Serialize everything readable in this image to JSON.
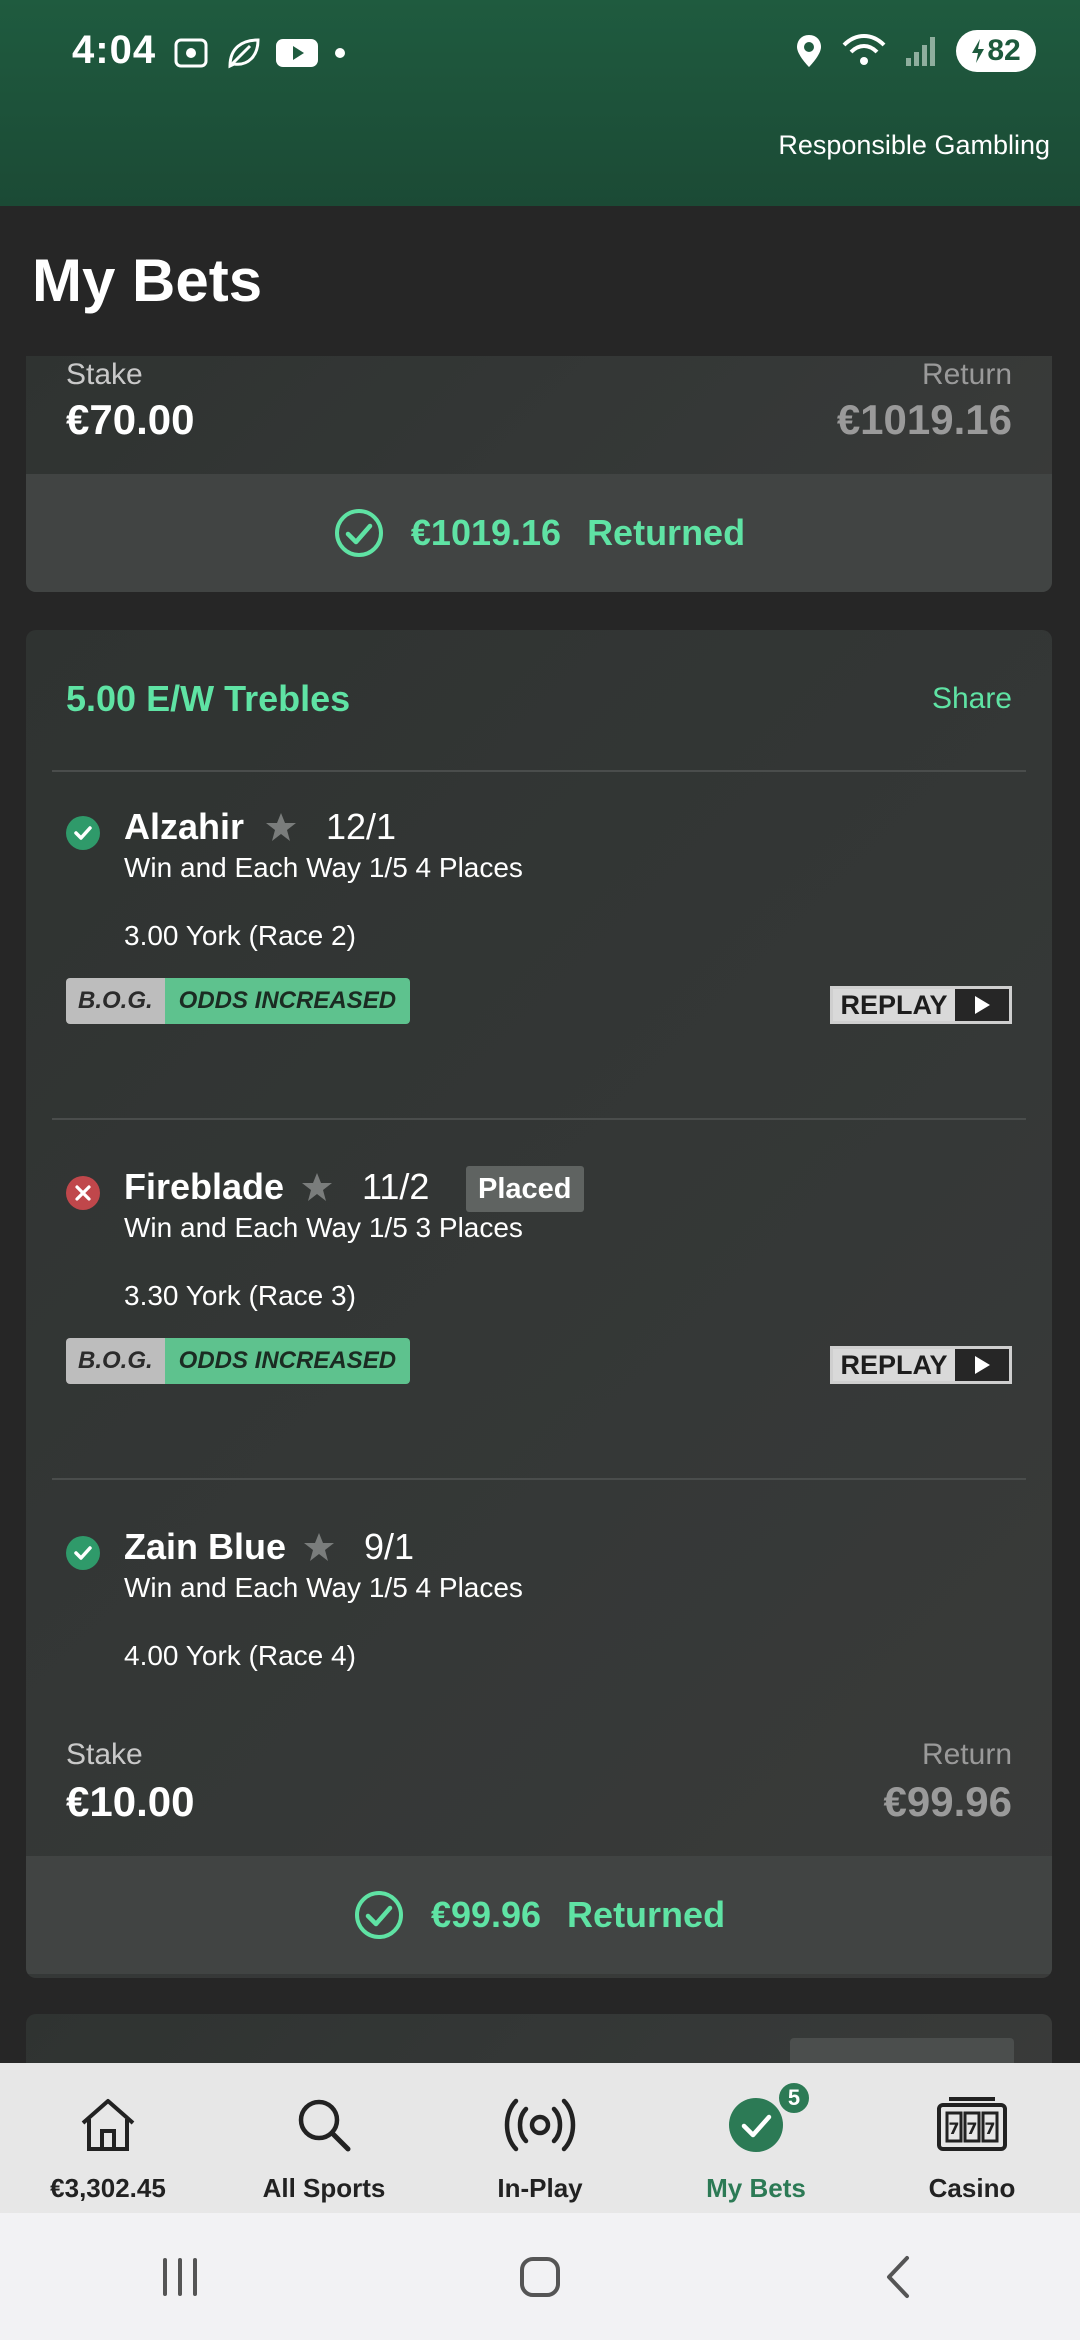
{
  "status_bar": {
    "time": "4:04",
    "battery": "82"
  },
  "header": {
    "responsible_gambling": "Responsible Gambling",
    "title": "My Bets"
  },
  "bet_prev": {
    "stake_label": "Stake",
    "stake": "€70.00",
    "return_label": "Return",
    "return": "€1019.16",
    "returned_amount": "€1019.16",
    "returned_label": "Returned"
  },
  "bet_main": {
    "type": "5.00 E/W Trebles",
    "share": "Share",
    "selections": [
      {
        "name": "Alzahir",
        "odds": "12/1",
        "market": "Win and Each Way 1/5 4 Places",
        "event": "3.00 York (Race 2)",
        "status": "won",
        "bog": "B.O.G.",
        "odds_increased": "ODDS INCREASED",
        "replay": "REPLAY"
      },
      {
        "name": "Fireblade",
        "odds": "11/2",
        "placed": "Placed",
        "market": "Win and Each Way 1/5 3 Places",
        "event": "3.30 York (Race 3)",
        "status": "lost",
        "bog": "B.O.G.",
        "odds_increased": "ODDS INCREASED",
        "replay": "REPLAY"
      },
      {
        "name": "Zain Blue",
        "odds": "9/1",
        "market": "Win and Each Way 1/5 4 Places",
        "event": "4.00 York (Race 4)",
        "status": "won"
      }
    ],
    "stake_label": "Stake",
    "stake": "€10.00",
    "return_label": "Return",
    "return": "€99.96",
    "returned_amount": "€99.96",
    "returned_label": "Returned"
  },
  "bottom_nav": {
    "balance": "€3,302.45",
    "all_sports": "All Sports",
    "in_play": "In-Play",
    "my_bets": "My Bets",
    "my_bets_badge": "5",
    "casino": "Casino"
  },
  "colors": {
    "accent": "#5fe3a4",
    "brand_green": "#2c7a55",
    "header_bg": "#1f5b3f",
    "lost_red": "#c0474b"
  }
}
